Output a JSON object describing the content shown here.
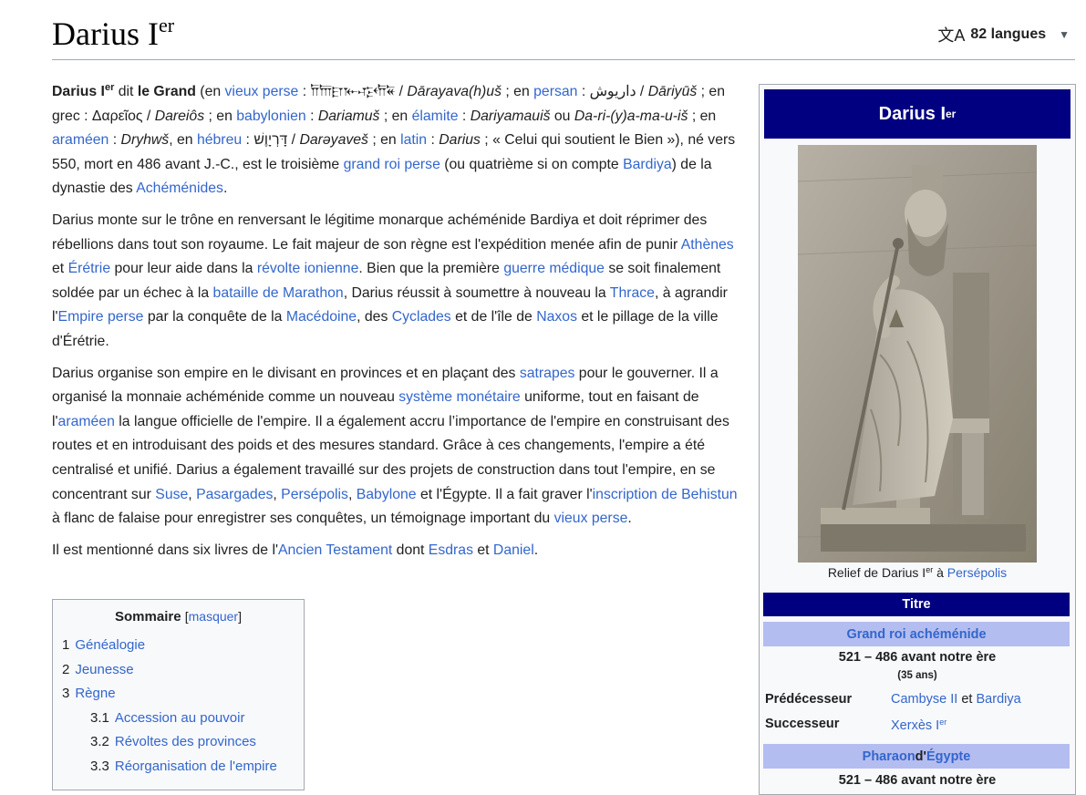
{
  "header": {
    "title": "Darius I",
    "title_sup": "er",
    "lang_icon": "文A",
    "lang_label": "82 langues",
    "chevron": "⌄"
  },
  "article": {
    "p1": {
      "a": "Darius I",
      "a_sup": "er",
      "b": " dit ",
      "c": "le Grand",
      "d": " (en ",
      "l_vieux_perse": "vieux perse",
      "e": " : 𐎭𐎠𐎼𐎹𐎺𐎢𐏁 / ",
      "f": "Dārayava(h)uš",
      "g": " ; en ",
      "l_persan": "persan",
      "h": " : داریوش / ",
      "i": "Dāriyūš",
      "j": " ; en grec : Δαρεῖος / ",
      "k": "Dareiôs",
      "l": " ; en ",
      "l_babylonien": "babylonien",
      "m": " : ",
      "n": "Dariamuš",
      "o": " ; en ",
      "l_elamite": "élamite",
      "p": " : ",
      "q": "Dariyamauiš",
      "r": " ou ",
      "s": "Da-ri-(y)a-ma-u-iš",
      "t": " ; en ",
      "l_arameen": "araméen",
      "u": " : ",
      "v": "Dryhwš",
      "w": ", en ",
      "l_hebreu": "hébreu",
      "x": " : דָּרְיָוֶשׁ / ",
      "y": "Darəyaveš",
      "z": " ; en ",
      "l_latin": "latin",
      "aa": " : ",
      "ab": "Darius",
      "ac": " ; « Celui qui soutient le Bien »), né vers 550, mort en 486 avant J.-C., est le troisième ",
      "l_grand_roi": "grand roi perse",
      "ad": " (ou quatrième si on compte ",
      "l_bardiya": "Bardiya",
      "ae": ") de la dynastie des ",
      "l_achemenides": "Achéménides",
      "af": "."
    },
    "p2": {
      "a": "Darius monte sur le trône en renversant le légitime monarque achéménide Bardiya et doit réprimer des rébellions dans tout son royaume. Le fait majeur de son règne est l'expédition menée afin de punir ",
      "l_athenes": "Athènes",
      "b": " et ",
      "l_eretrie": "Érétrie",
      "c": " pour leur aide dans la ",
      "l_revolte": "révolte ionienne",
      "d": ". Bien que la première ",
      "l_guerre": "guerre médique",
      "e": " se soit finalement soldée par un échec à la ",
      "l_marathon": "bataille de Marathon",
      "f": ", Darius réussit à soumettre à nouveau la ",
      "l_thrace": "Thrace",
      "g": ", à agrandir l'",
      "l_empire": "Empire perse",
      "h": " par la conquête de la ",
      "l_macedoine": "Macédoine",
      "i": ", des ",
      "l_cyclades": "Cyclades",
      "j": " et de l'île de ",
      "l_naxos": "Naxos",
      "k": " et le pillage de la ville d'Érétrie."
    },
    "p3": {
      "a": "Darius organise son empire en le divisant en provinces et en plaçant des ",
      "l_satrapes": "satrapes",
      "b": " pour le gouverner. Il a organisé la monnaie achéménide comme un nouveau ",
      "l_systeme": "système monétaire",
      "c": " uniforme, tout en faisant de l'",
      "l_arameen": "araméen",
      "d": " la langue officielle de l'empire. Il a également accru l’importance de l'empire en construisant des routes et en introduisant des poids et des mesures standard. Grâce à ces changements, l'empire a été centralisé et unifié. Darius a également travaillé sur des projets de construction dans tout l'empire, en se concentrant sur ",
      "l_suse": "Suse",
      "e": ", ",
      "l_pasargades": "Pasargades",
      "f": ", ",
      "l_persepolis": "Persépolis",
      "g": ", ",
      "l_babylone": "Babylone",
      "h": " et l'Égypte. Il a fait graver l'",
      "l_behistun": "inscription de Behistun",
      "i": " à flanc de falaise pour enregistrer ses conquêtes, un témoignage important du ",
      "l_vieux_perse": "vieux perse",
      "j": "."
    },
    "p4": {
      "a": "Il est mentionné dans six livres de l'",
      "l_ancien": "Ancien Testament",
      "b": " dont ",
      "l_esdras": "Esdras",
      "c": " et ",
      "l_daniel": "Daniel",
      "d": "."
    }
  },
  "toc": {
    "title": "Sommaire",
    "toggle_open": "[",
    "toggle_label": "masquer",
    "toggle_close": "]",
    "items": [
      {
        "num": "1",
        "label": "Généalogie"
      },
      {
        "num": "2",
        "label": "Jeunesse"
      },
      {
        "num": "3",
        "label": "Règne"
      },
      {
        "num": "3.1",
        "label": "Accession au pouvoir"
      },
      {
        "num": "3.2",
        "label": "Révoltes des provinces"
      },
      {
        "num": "3.3",
        "label": "Réorganisation de l'empire"
      }
    ]
  },
  "infobox": {
    "title": "Darius I",
    "title_sup": "er",
    "caption_a": "Relief de Darius I",
    "caption_sup": "er",
    "caption_b": " à ",
    "caption_link": "Persépolis",
    "section_titre": "Titre",
    "role": "Grand roi achéménide",
    "reign": "521 – 486 avant notre ère",
    "years": "(35 ans)",
    "pred_label": "Prédécesseur",
    "pred_a": "Cambyse II",
    "pred_and": " et ",
    "pred_b": "Bardiya",
    "succ_label": "Successeur",
    "succ": "Xerxès I",
    "succ_sup": "er",
    "pharaon_a": "Pharaon",
    "pharaon_b": " d'",
    "pharaon_c": "Égypte",
    "bottom_partial": "521 – 486 avant notre ère",
    "colors": {
      "navy": "#000080",
      "lavender": "#b4bdf0",
      "link": "#3366cc"
    }
  }
}
